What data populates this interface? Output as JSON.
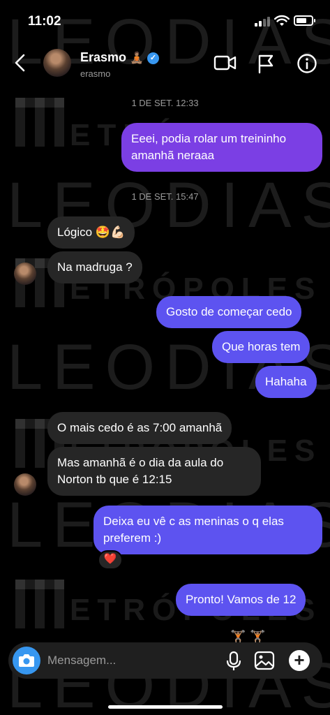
{
  "status_bar": {
    "time": "11:02"
  },
  "watermark": {
    "word1": "LEODIAS",
    "word2": "ETRÓPOLES"
  },
  "header": {
    "name": "Erasmo",
    "name_emoji": "🧘🏽",
    "username": "erasmo",
    "icons": [
      "back-icon",
      "video-call-icon",
      "flag-icon",
      "info-icon"
    ]
  },
  "chat": {
    "timestamps": [
      "1 DE SET. 12:33",
      "1 DE SET. 15:47"
    ],
    "messages": [
      {
        "from": "me",
        "text": "Eeei, podia rolar um treininho amanhã neraaa"
      },
      {
        "from": "them",
        "text": "Lógico 🤩💪🏻"
      },
      {
        "from": "them",
        "text": "Na madruga ?"
      },
      {
        "from": "me",
        "text": "Gosto de começar cedo"
      },
      {
        "from": "me",
        "text": "Que horas tem"
      },
      {
        "from": "me",
        "text": "Hahaha"
      },
      {
        "from": "them",
        "text": "O mais cedo é as 7:00 amanhã"
      },
      {
        "from": "them",
        "text": "Mas amanhã é o dia da aula do Norton tb que é 12:15"
      },
      {
        "from": "me",
        "text": "Deixa eu vê c as meninas o q elas preferem :)",
        "reaction": "❤️"
      },
      {
        "from": "me",
        "text": "Pronto! Vamos de 12"
      }
    ]
  },
  "composer": {
    "placeholder": "Mensagem..."
  },
  "colors": {
    "outgoing_purple": "#7b3fe4",
    "outgoing_blue": "#5d53f0",
    "incoming": "#262626",
    "camera_blue": "#3797f0"
  }
}
